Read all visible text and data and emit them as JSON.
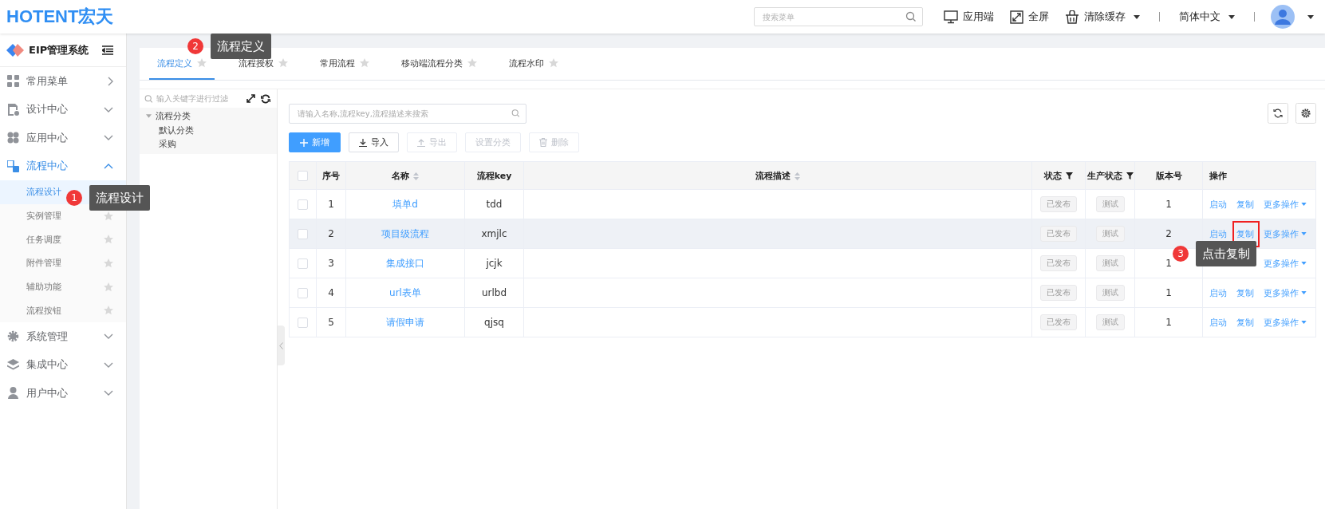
{
  "header": {
    "logo": "HOTENT宏天",
    "search": {
      "placeholder": "搜索菜单"
    },
    "actions": [
      {
        "kind": "monitor",
        "label": "应用端",
        "dropdown": false
      },
      {
        "kind": "fullscreen",
        "label": "全屏",
        "dropdown": false
      },
      {
        "kind": "basket",
        "label": "清除缓存",
        "dropdown": true
      }
    ],
    "language": "简体中文"
  },
  "sidebar": {
    "title": "EIP管理系统",
    "groups": [
      {
        "label": "常用菜单",
        "kind": "flyout",
        "selected": false
      },
      {
        "label": "设计中心",
        "kind": "folder",
        "expanded": false,
        "selected": false
      },
      {
        "label": "应用中心",
        "kind": "folder",
        "expanded": false,
        "selected": false
      },
      {
        "label": "流程中心",
        "kind": "folder",
        "expanded": true,
        "selected": true,
        "children": [
          {
            "label": "流程设计",
            "selected": true
          },
          {
            "label": "实例管理",
            "selected": false
          },
          {
            "label": "任务调度",
            "selected": false
          },
          {
            "label": "附件管理",
            "selected": false
          },
          {
            "label": "辅助功能",
            "selected": false
          },
          {
            "label": "流程按钮",
            "selected": false
          }
        ]
      },
      {
        "label": "系统管理",
        "kind": "folder",
        "expanded": false,
        "selected": false
      },
      {
        "label": "集成中心",
        "kind": "folder",
        "expanded": false,
        "selected": false
      },
      {
        "label": "用户中心",
        "kind": "folder",
        "expanded": false,
        "selected": false
      }
    ]
  },
  "tabs": [
    {
      "label": "流程定义",
      "selected": true
    },
    {
      "label": "流程授权",
      "selected": false
    },
    {
      "label": "常用流程",
      "selected": false
    },
    {
      "label": "移动端流程分类",
      "selected": false
    },
    {
      "label": "流程水印",
      "selected": false
    }
  ],
  "tree": {
    "placeholder": "输入关键字进行过滤",
    "nodes": [
      {
        "label": "流程分类",
        "expanded": true,
        "children": [
          {
            "label": "默认分类"
          },
          {
            "label": "采购"
          }
        ]
      }
    ]
  },
  "toolbar": {
    "search": {
      "placeholder": "请输入名称,流程key,流程描述来搜索"
    },
    "buttons": [
      {
        "label": "新增",
        "kind": "primary",
        "disabled": false
      },
      {
        "label": "导入",
        "kind": "default",
        "disabled": false
      },
      {
        "label": "导出",
        "kind": "default",
        "disabled": true
      },
      {
        "label": "设置分类",
        "kind": "default",
        "disabled": true
      },
      {
        "label": "删除",
        "kind": "default",
        "disabled": true
      }
    ]
  },
  "table": {
    "all_checked": false,
    "columns": [
      {
        "label": "序号",
        "kind": "plain"
      },
      {
        "label": "名称",
        "kind": "sort"
      },
      {
        "label": "流程key",
        "kind": "plain"
      },
      {
        "label": "流程描述",
        "kind": "sort"
      },
      {
        "label": "状态",
        "kind": "filter"
      },
      {
        "label": "生产状态",
        "kind": "filter"
      },
      {
        "label": "版本号",
        "kind": "plain"
      },
      {
        "label": "操作",
        "kind": "plain"
      }
    ],
    "rows": [
      {
        "checked": false,
        "hovered": false,
        "no": "1",
        "name": "填单d",
        "key": "tdd",
        "status": "已发布",
        "prod_status": "测试",
        "version": "1",
        "actions": [
          {
            "kind": "start",
            "label": "启动",
            "highlighted": false
          },
          {
            "kind": "copy",
            "label": "复制",
            "highlighted": false
          },
          {
            "kind": "more",
            "label": "更多操作",
            "highlighted": false
          }
        ]
      },
      {
        "checked": false,
        "hovered": true,
        "no": "2",
        "name": "项目级流程",
        "key": "xmjlc",
        "status": "已发布",
        "prod_status": "测试",
        "version": "2",
        "actions": [
          {
            "kind": "start",
            "label": "启动",
            "highlighted": false
          },
          {
            "kind": "copy",
            "label": "复制",
            "highlighted": true
          },
          {
            "kind": "more",
            "label": "更多操作",
            "highlighted": false
          }
        ]
      },
      {
        "checked": false,
        "hovered": false,
        "no": "3",
        "name": "集成接口",
        "key": "jcjk",
        "status": "已发布",
        "prod_status": "测试",
        "version": "1",
        "actions": [
          {
            "kind": "more",
            "label": "更多操作",
            "highlighted": false
          }
        ]
      },
      {
        "checked": false,
        "hovered": false,
        "no": "4",
        "name": "url表单",
        "key": "urlbd",
        "status": "已发布",
        "prod_status": "测试",
        "version": "1",
        "actions": [
          {
            "kind": "start",
            "label": "启动",
            "highlighted": false
          },
          {
            "kind": "copy",
            "label": "复制",
            "highlighted": false
          },
          {
            "kind": "more",
            "label": "更多操作",
            "highlighted": false
          }
        ]
      },
      {
        "checked": false,
        "hovered": false,
        "no": "5",
        "name": "请假申请",
        "key": "qjsq",
        "status": "已发布",
        "prod_status": "测试",
        "version": "1",
        "actions": [
          {
            "kind": "start",
            "label": "启动",
            "highlighted": false
          },
          {
            "kind": "copy",
            "label": "复制",
            "highlighted": false
          },
          {
            "kind": "more",
            "label": "更多操作",
            "highlighted": false
          }
        ]
      }
    ]
  },
  "annotations": [
    {
      "number": "1",
      "text": "流程设计"
    },
    {
      "number": "2",
      "text": "流程定义"
    },
    {
      "number": "3",
      "text": "点击复制"
    }
  ]
}
